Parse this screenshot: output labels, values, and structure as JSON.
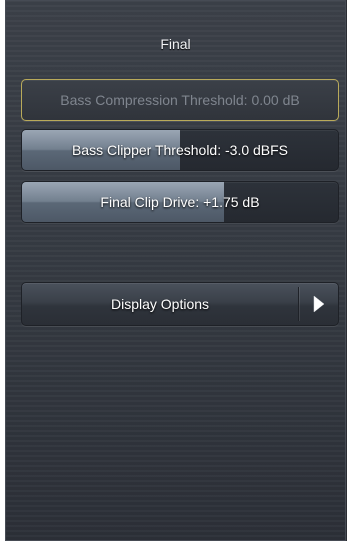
{
  "panel": {
    "title": "Final"
  },
  "controls": [
    {
      "label": "Bass Compression Threshold: 0.00 dB",
      "level": 0,
      "enabled": false
    },
    {
      "label": "Bass Clipper Threshold: -3.0 dBFS",
      "level": 0.5,
      "enabled": true
    },
    {
      "label": "Final Clip Drive: +1.75 dB",
      "level": 0.64,
      "enabled": true
    }
  ],
  "menu": {
    "display_options_label": "Display Options",
    "arrow_icon": "chevron-right-icon"
  },
  "colors": {
    "panel_bg": "#353a42",
    "disabled_border": "#b9aa5a",
    "fill": "#73808f",
    "text": "#ffffff",
    "disabled_text": "#7f858e"
  }
}
